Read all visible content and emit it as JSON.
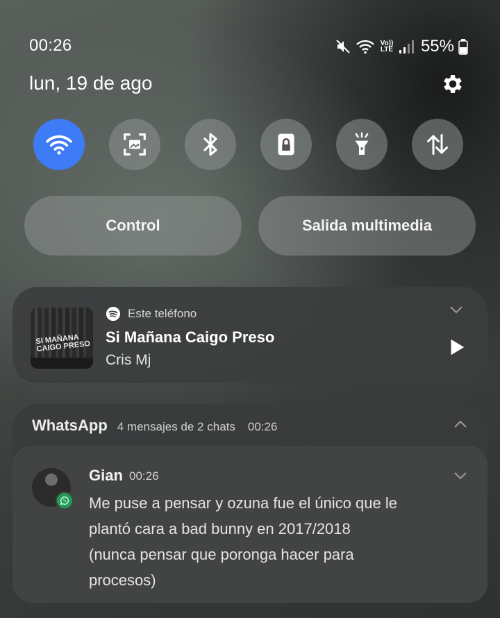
{
  "status_bar": {
    "time": "00:26",
    "network_label": "Vo)) LTE",
    "battery_percent": "55%",
    "icons": [
      "mute-icon",
      "wifi-icon",
      "volte-icon",
      "signal-icon",
      "battery-icon"
    ]
  },
  "date": "lun, 19 de ago",
  "quick_settings": [
    {
      "name": "wifi",
      "icon": "wifi-icon",
      "active": true
    },
    {
      "name": "screenshot",
      "icon": "screen-capture-icon",
      "active": false
    },
    {
      "name": "bluetooth",
      "icon": "bluetooth-icon",
      "active": false
    },
    {
      "name": "rotation-lock",
      "icon": "lock-icon",
      "active": false
    },
    {
      "name": "flashlight",
      "icon": "flashlight-icon",
      "active": false
    },
    {
      "name": "mobile-data",
      "icon": "data-transfer-icon",
      "active": false
    }
  ],
  "pills": {
    "control": "Control",
    "media_output": "Salida multimedia"
  },
  "media": {
    "source": "Este teléfono",
    "title": "Si Mañana Caigo Preso",
    "artist": "Cris Mj",
    "album_art_text": "SI MAÑANA CAIGO PRESO"
  },
  "whatsapp": {
    "app_name": "WhatsApp",
    "summary": "4 mensajes de 2 chats",
    "time": "00:26",
    "notification": {
      "sender": "Gian",
      "time": "00:26",
      "message_lines": [
        "Me puse a pensar y ozuna fue el único que le",
        "plantó cara a bad bunny en 2017/2018",
        "(nunca pensar que poronga hacer para",
        "procesos)"
      ]
    }
  },
  "colors": {
    "accent": "#3e7bf7",
    "whatsapp_green": "#1f9e55"
  }
}
